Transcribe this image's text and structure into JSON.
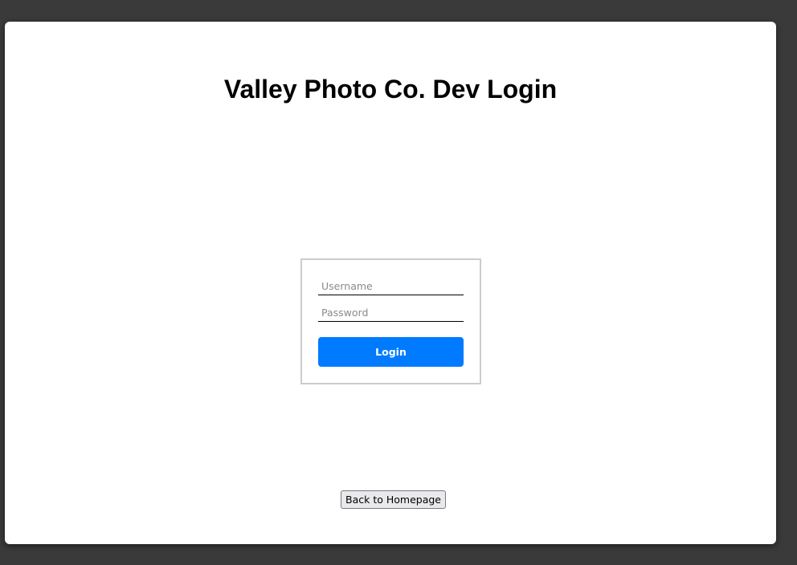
{
  "page": {
    "title": "Valley Photo Co. Dev Login"
  },
  "login_form": {
    "username": {
      "value": "",
      "placeholder": "Username"
    },
    "password": {
      "value": "",
      "placeholder": "Password"
    },
    "submit_label": "Login"
  },
  "back_button": {
    "label": "Back to Homepage"
  },
  "colors": {
    "accent": "#007bff",
    "box_border": "#cccccc",
    "desktop_background": "#3a3a3a"
  }
}
